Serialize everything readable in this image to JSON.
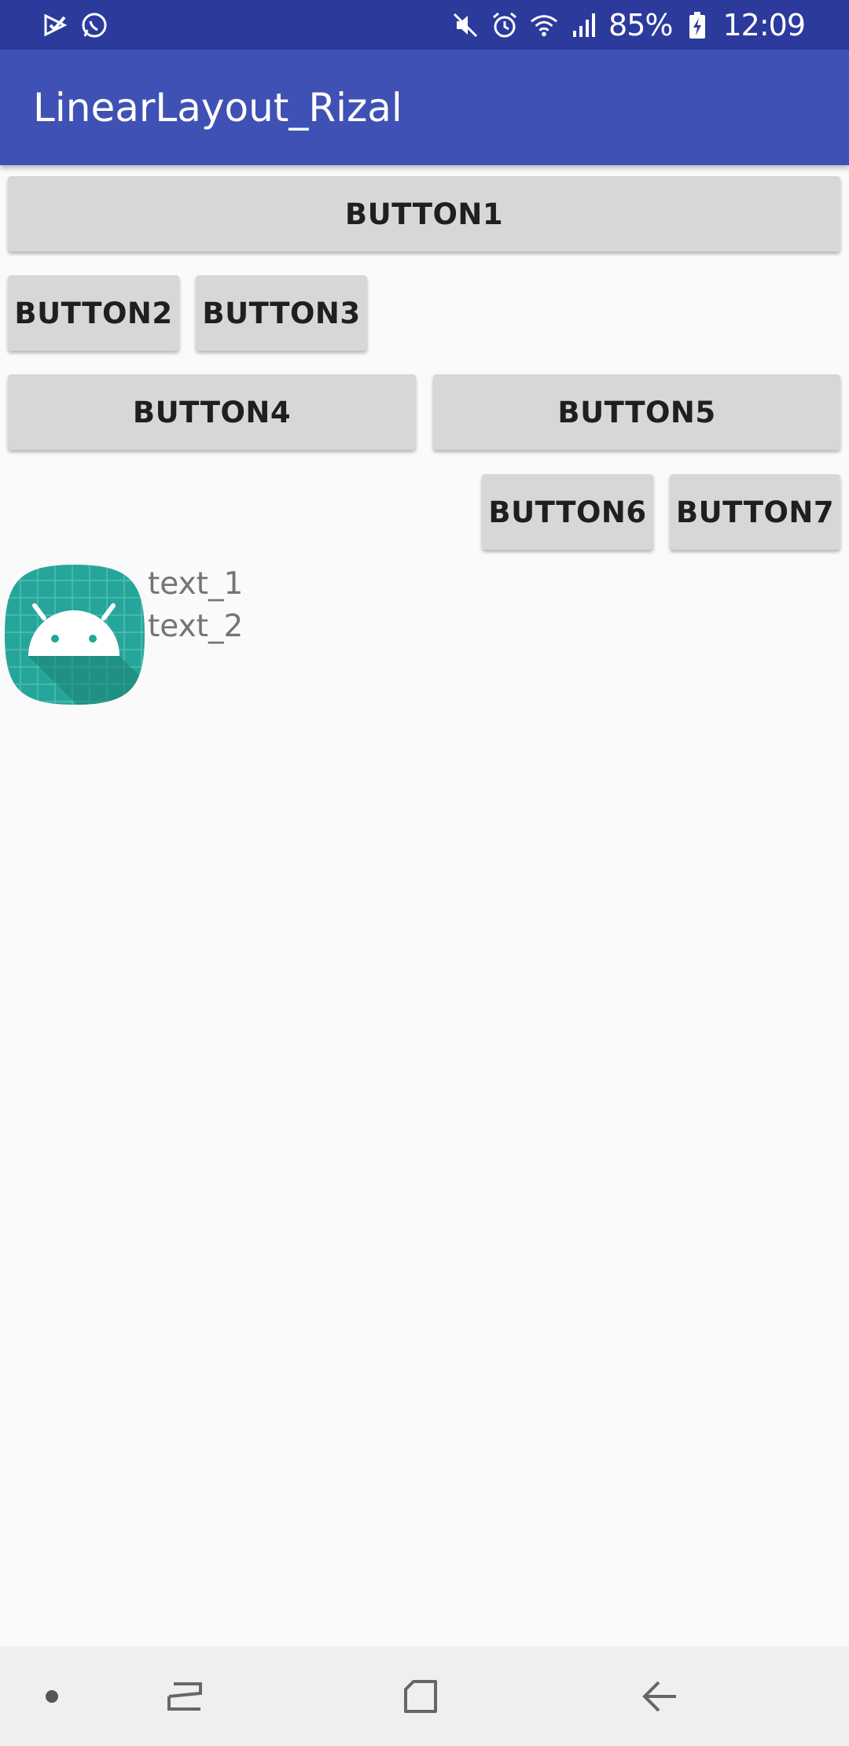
{
  "status_bar": {
    "battery": "85%",
    "time": "12:09",
    "icons": [
      "play-check-icon",
      "whatsapp-icon",
      "mute-icon",
      "alarm-icon",
      "wifi-icon",
      "signal-icon",
      "battery-charging-icon"
    ]
  },
  "app_bar": {
    "title": "LinearLayout_Rizal"
  },
  "buttons": {
    "b1": "BUTTON1",
    "b2": "BUTTON2",
    "b3": "BUTTON3",
    "b4": "BUTTON4",
    "b5": "BUTTON5",
    "b6": "BUTTON6",
    "b7": "BUTTON7"
  },
  "content": {
    "image_icon": "android-launcher-icon",
    "text_1": "text_1",
    "text_2": "text_2"
  },
  "nav_bar": {
    "icons": [
      "dot-icon",
      "recents-icon",
      "home-icon",
      "back-icon"
    ]
  },
  "colors": {
    "status_bar": "#2c3a9c",
    "app_bar": "#3f51b5",
    "button_bg": "#d6d7d7",
    "background": "#fafafa",
    "icon_teal": "#26a69a"
  }
}
